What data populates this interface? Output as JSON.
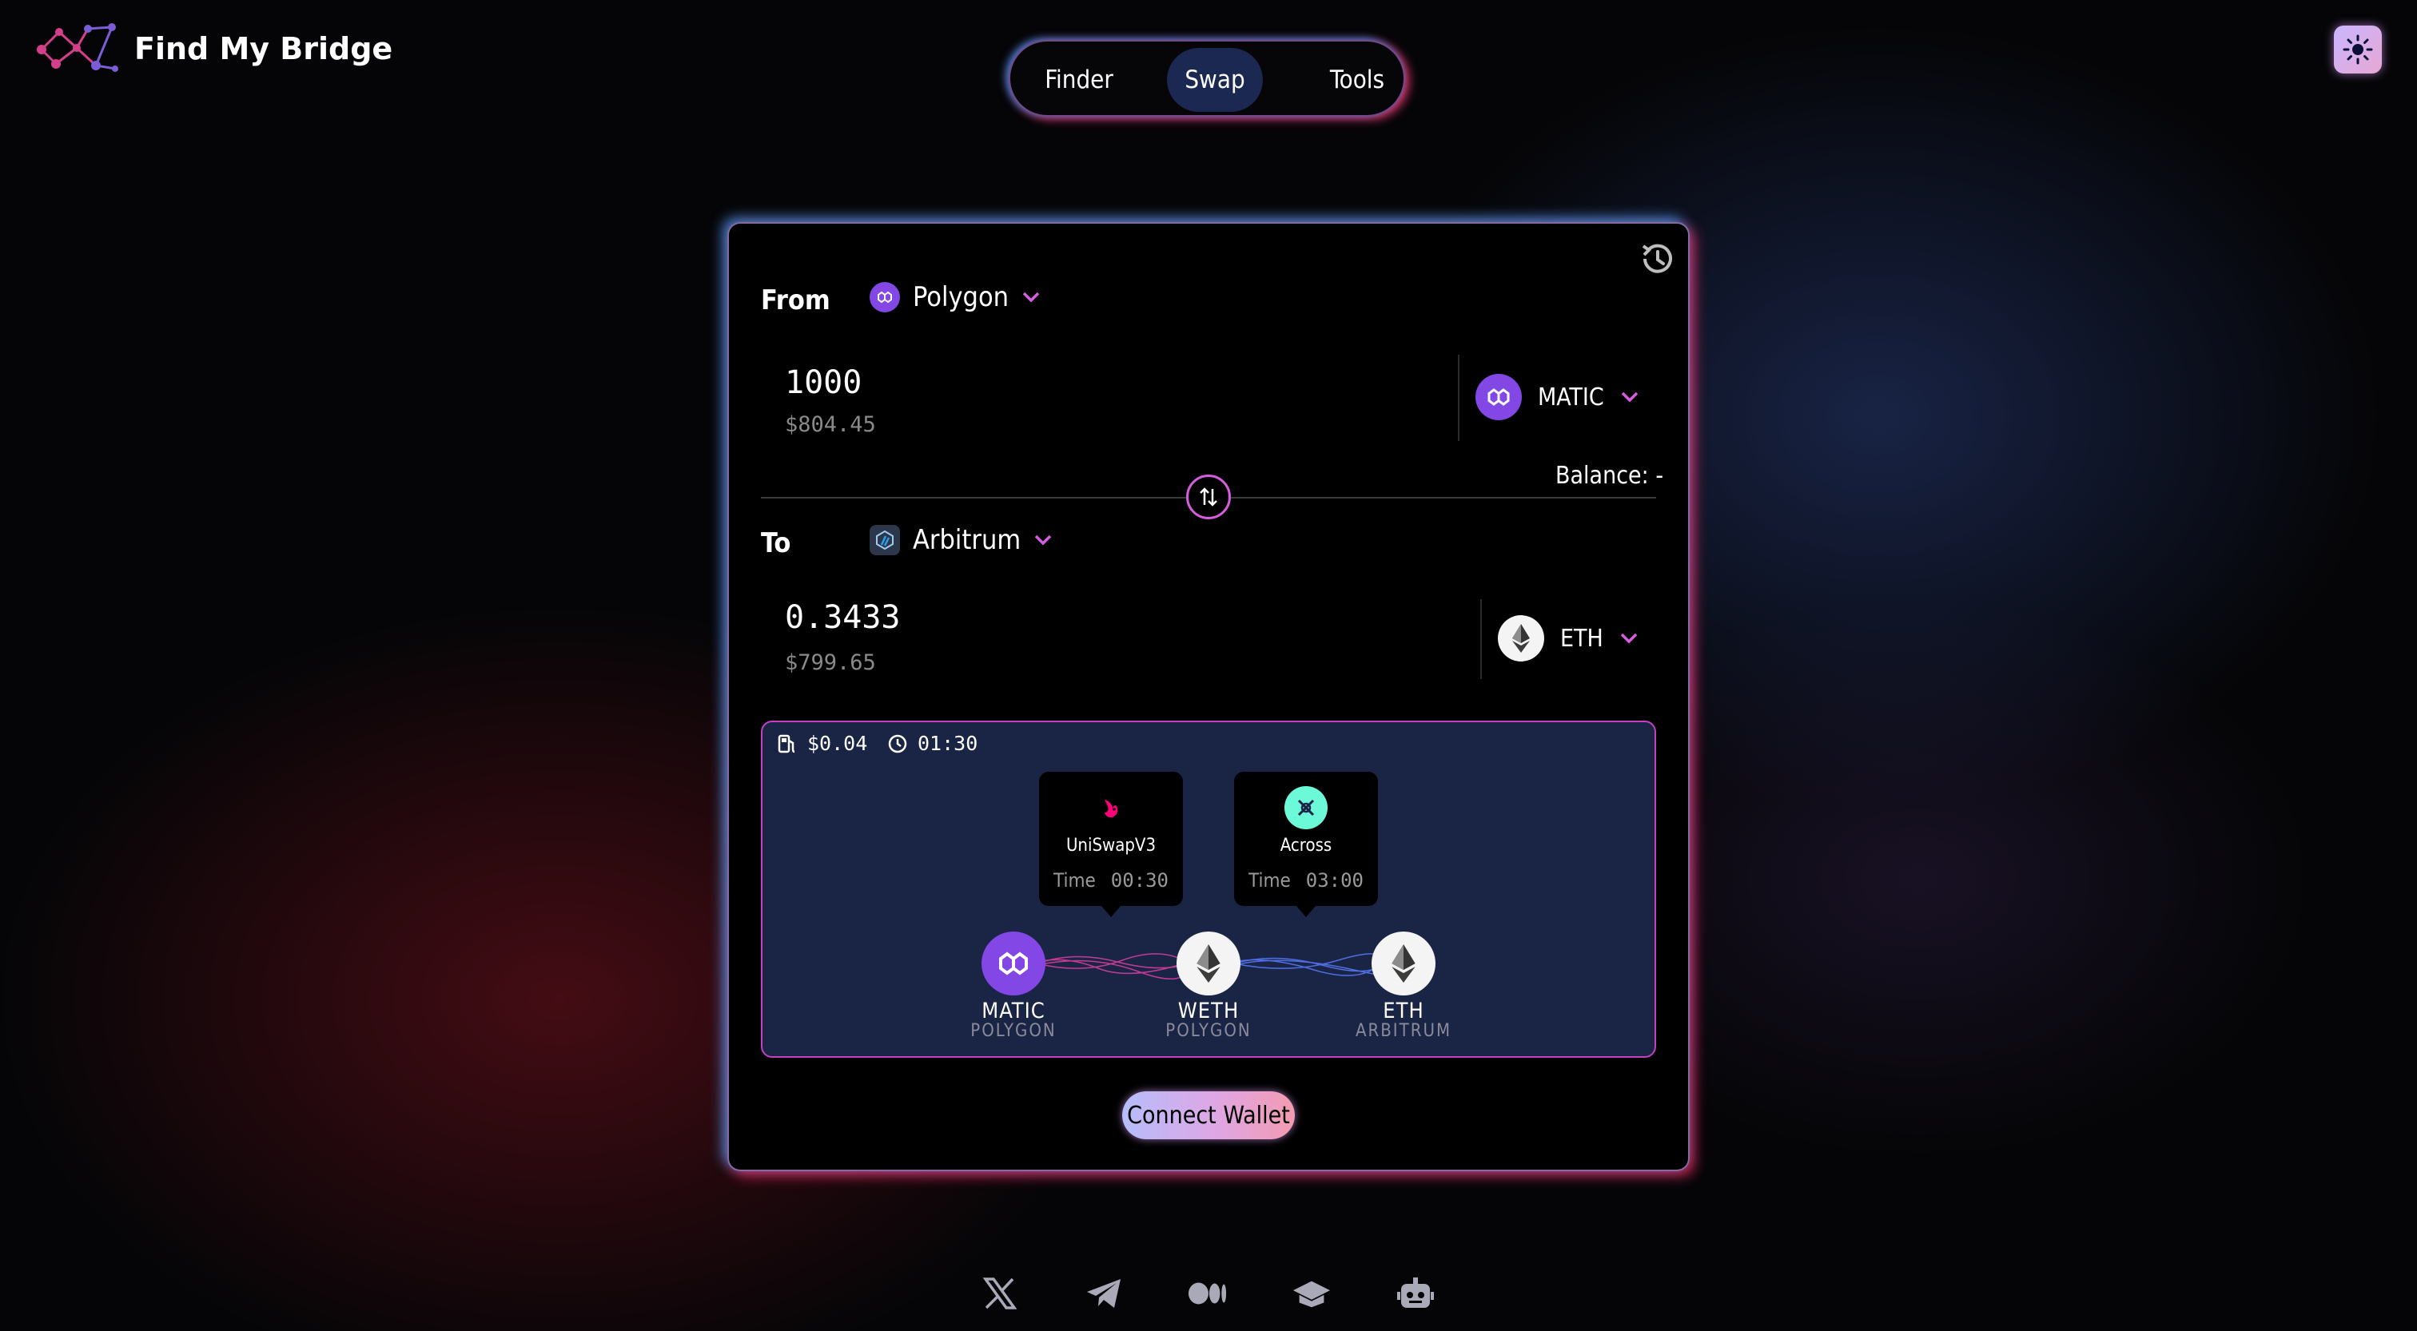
{
  "app": {
    "name": "Find My Bridge"
  },
  "nav": {
    "tabs": [
      {
        "label": "Finder"
      },
      {
        "label": "Swap",
        "active": true
      },
      {
        "label": "Tools"
      }
    ]
  },
  "swap": {
    "from": {
      "label": "From",
      "chain": "Polygon",
      "amount": "1000",
      "usd_value": "$804.45",
      "token": "MATIC",
      "balance": "Balance: -"
    },
    "to": {
      "label": "To",
      "chain": "Arbitrum",
      "amount": "0.3433",
      "usd_value": "$799.65",
      "token": "ETH"
    }
  },
  "route": {
    "gas_fee": "$0.04",
    "duration": "01:30",
    "steps": [
      {
        "protocol": "UniSwapV3",
        "time_label": "Time",
        "time": "00:30"
      },
      {
        "protocol": "Across",
        "time_label": "Time",
        "time": "03:00"
      }
    ],
    "nodes": [
      {
        "symbol": "MATIC",
        "chain": "POLYGON"
      },
      {
        "symbol": "WETH",
        "chain": "POLYGON"
      },
      {
        "symbol": "ETH",
        "chain": "ARBITRUM"
      }
    ]
  },
  "actions": {
    "connect_wallet": "Connect Wallet"
  },
  "colors": {
    "accent": "#d65ce0",
    "polygon": "#8247e5",
    "route_bg": "#1a2546",
    "across": "#6cf9d8",
    "uniswap": "#ff007a"
  },
  "footer": {
    "icons": [
      "x-icon",
      "telegram-icon",
      "medium-icon",
      "docs-icon",
      "bot-icon"
    ]
  }
}
